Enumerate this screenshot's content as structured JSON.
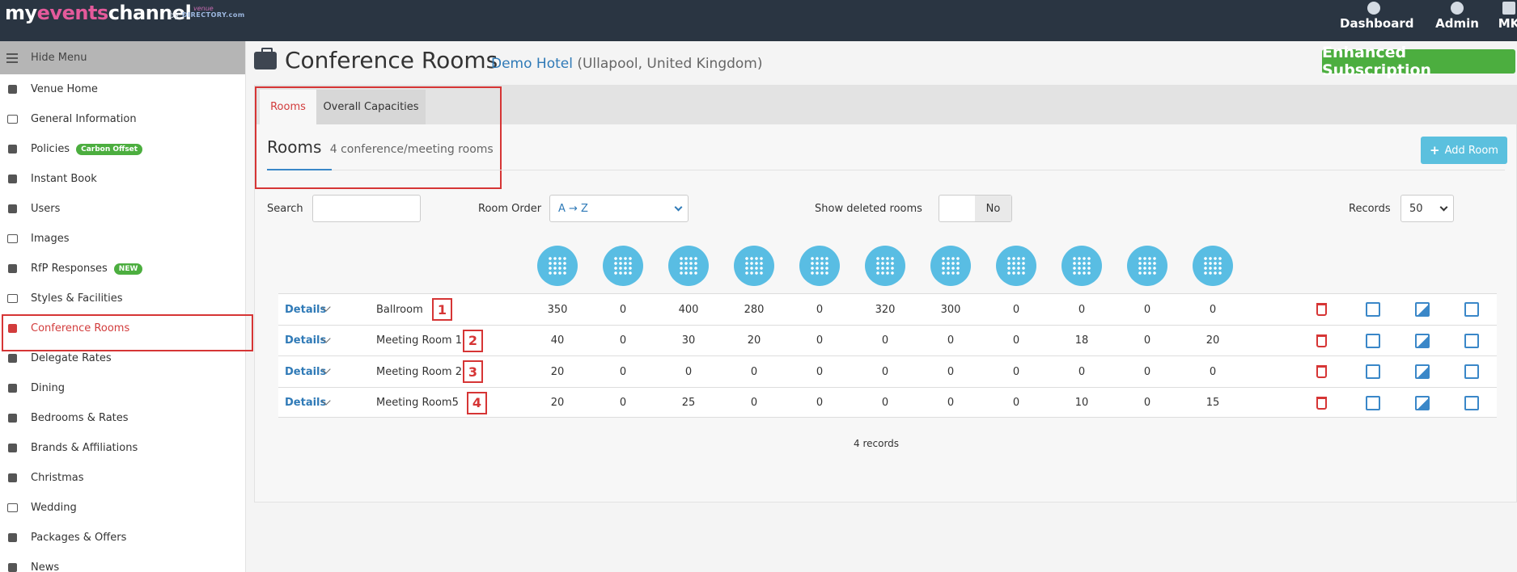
{
  "topbar": {
    "logo": {
      "part1": "my",
      "part2": "events",
      "part3": "channel",
      "by": "by",
      "venue": "venue",
      "directory": "DIRECTORY.com"
    },
    "nav": [
      {
        "label": "Dashboard",
        "icon": "dashboard-icon"
      },
      {
        "label": "Admin",
        "icon": "admin-icon"
      },
      {
        "label": "MK",
        "icon": "user-icon"
      }
    ]
  },
  "sidebar": {
    "hide_menu": "Hide Menu",
    "items": [
      {
        "label": "Venue Home",
        "icon": "home-icon"
      },
      {
        "label": "General Information",
        "icon": "edit-icon"
      },
      {
        "label": "Policies",
        "icon": "document-icon",
        "badge": "Carbon Offset"
      },
      {
        "label": "Instant Book",
        "icon": "calendar-icon"
      },
      {
        "label": "Users",
        "icon": "user-icon"
      },
      {
        "label": "Images",
        "icon": "image-icon"
      },
      {
        "label": "RfP Responses",
        "icon": "question-icon",
        "badge": "NEW"
      },
      {
        "label": "Styles & Facilities",
        "icon": "monitor-icon"
      },
      {
        "label": "Conference Rooms",
        "icon": "briefcase-icon",
        "active": true
      },
      {
        "label": "Delegate Rates",
        "icon": "calculator-icon"
      },
      {
        "label": "Dining",
        "icon": "cutlery-icon"
      },
      {
        "label": "Bedrooms & Rates",
        "icon": "bed-icon"
      },
      {
        "label": "Brands & Affiliations",
        "icon": "book-icon"
      },
      {
        "label": "Christmas",
        "icon": "tree-icon"
      },
      {
        "label": "Wedding",
        "icon": "heart-icon"
      },
      {
        "label": "Packages & Offers",
        "icon": "tag-icon"
      },
      {
        "label": "News",
        "icon": "news-icon"
      }
    ]
  },
  "header": {
    "title": "Conference Rooms",
    "hotel_name": "Demo Hotel",
    "hotel_location": "(Ullapool, United Kingdom)",
    "subscription": "Enhanced Subscription"
  },
  "tabs": [
    {
      "label": "Rooms"
    },
    {
      "label": "Overall Capacities"
    }
  ],
  "section": {
    "heading": "Rooms",
    "subheading": "4 conference/meeting rooms",
    "add_button": "Add Room"
  },
  "filters": {
    "search_label": "Search",
    "search_value": "",
    "order_label": "Room Order",
    "order_value": "A → Z",
    "deleted_label": "Show deleted rooms",
    "deleted_value": "No",
    "records_label": "Records",
    "records_value": "50"
  },
  "layout_icons": [
    "theatre-layout-icon",
    "classroom-layout-icon",
    "reception-layout-icon",
    "boardroom-tables-layout-icon",
    "lectern-layout-icon",
    "cabaret-layout-icon",
    "banquet-layout-icon",
    "dinner-layout-icon",
    "boardroom-layout-icon",
    "hollow-square-layout-icon",
    "u-shape-layout-icon"
  ],
  "rooms": [
    {
      "details": "Details",
      "name": "Ballroom",
      "marker": "1",
      "capacities": [
        "350",
        "0",
        "400",
        "280",
        "0",
        "320",
        "300",
        "0",
        "0",
        "0",
        "0"
      ]
    },
    {
      "details": "Details",
      "name": "Meeting Room 1",
      "marker": "2",
      "capacities": [
        "40",
        "0",
        "30",
        "20",
        "0",
        "0",
        "0",
        "0",
        "18",
        "0",
        "20"
      ]
    },
    {
      "details": "Details",
      "name": "Meeting Room 2",
      "marker": "3",
      "capacities": [
        "20",
        "0",
        "0",
        "0",
        "0",
        "0",
        "0",
        "0",
        "0",
        "0",
        "0"
      ]
    },
    {
      "details": "Details",
      "name": "Meeting Room5",
      "marker": "4",
      "capacities": [
        "20",
        "0",
        "25",
        "0",
        "0",
        "0",
        "0",
        "0",
        "10",
        "0",
        "15"
      ]
    }
  ],
  "records_count": "4 records",
  "colors": {
    "topbar": "#2a3542",
    "accent": "#2f7ab7",
    "success": "#4cae3f",
    "danger": "#d63535",
    "info": "#5bc0de"
  }
}
